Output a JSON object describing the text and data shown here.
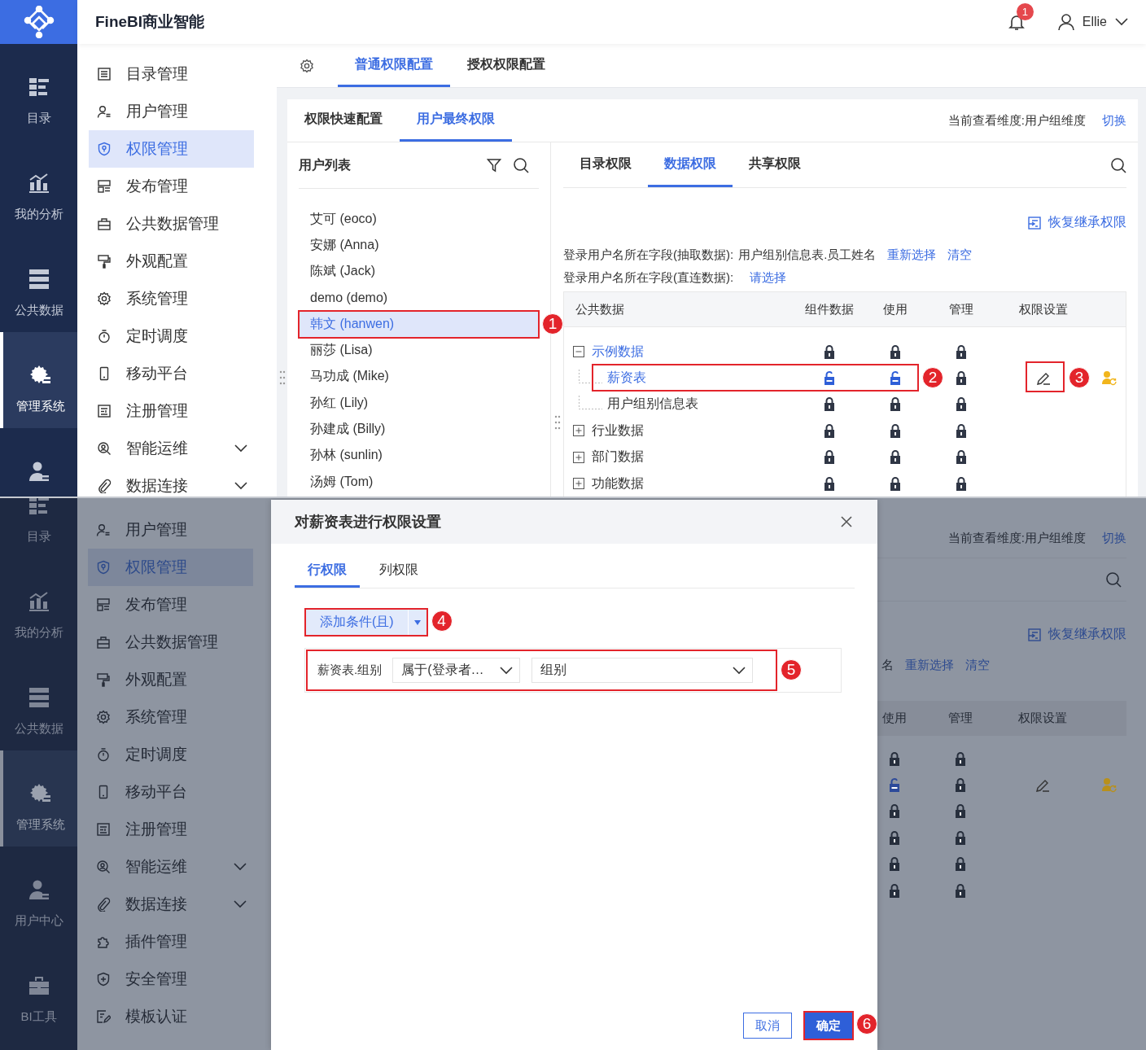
{
  "top_screen": {
    "app_title": "FineBI商业智能",
    "notification_count": "1",
    "user_name": "Ellie",
    "nav_rail": [
      {
        "label": "目录",
        "selected": false
      },
      {
        "label": "我的分析",
        "selected": false
      },
      {
        "label": "公共数据",
        "selected": false
      },
      {
        "label": "管理系统",
        "selected": true
      },
      {
        "selected": false
      }
    ],
    "menu": [
      {
        "label": "目录管理",
        "selected": false
      },
      {
        "label": "用户管理",
        "selected": false
      },
      {
        "label": "权限管理",
        "selected": true
      },
      {
        "label": "发布管理",
        "selected": false
      },
      {
        "label": "公共数据管理",
        "selected": false
      },
      {
        "label": "外观配置",
        "selected": false
      },
      {
        "label": "系统管理",
        "selected": false
      },
      {
        "label": "定时调度",
        "selected": false
      },
      {
        "label": "移动平台",
        "selected": false
      },
      {
        "label": "注册管理",
        "selected": false
      },
      {
        "label": "智能运维",
        "selected": false,
        "expanded": false
      },
      {
        "label": "数据连接",
        "selected": false,
        "expanded": false
      }
    ],
    "page_tabs": [
      {
        "label": "普通权限配置",
        "selected": true
      },
      {
        "label": "授权权限配置",
        "selected": false
      }
    ],
    "card_tabs": [
      {
        "label": "权限快速配置",
        "selected": false
      },
      {
        "label": "用户最终权限",
        "selected": true
      }
    ],
    "view_dimension": "当前查看维度:用户组维度",
    "switch_link": "切换",
    "user_list": {
      "title": "用户列表",
      "users": [
        {
          "name": "艾可 (eoco)",
          "selected": false
        },
        {
          "name": "安娜 (Anna)",
          "selected": false
        },
        {
          "name": "陈斌 (Jack)",
          "selected": false
        },
        {
          "name": "demo (demo)",
          "selected": false
        },
        {
          "name": "韩文 (hanwen)",
          "selected": true,
          "callout": "1"
        },
        {
          "name": "丽莎 (Lisa)",
          "selected": false
        },
        {
          "name": "马功成 (Mike)",
          "selected": false
        },
        {
          "name": "孙红 (Lily)",
          "selected": false
        },
        {
          "name": "孙建成 (Billy)",
          "selected": false
        },
        {
          "name": "孙林 (sunlin)",
          "selected": false
        },
        {
          "name": "汤姆 (Tom)",
          "selected": false
        }
      ]
    },
    "permission_tabs": [
      {
        "label": "目录权限",
        "selected": false
      },
      {
        "label": "数据权限",
        "selected": true
      },
      {
        "label": "共享权限",
        "selected": false
      }
    ],
    "restore_link": "恢复继承权限",
    "extract_field": {
      "label": "登录用户名所在字段(抽取数据):",
      "value": "用户组别信息表.员工姓名",
      "links": [
        "重新选择",
        "清空"
      ]
    },
    "direct_field": {
      "label": "登录用户名所在字段(直连数据):",
      "links": [
        "请选择"
      ]
    },
    "table": {
      "columns": [
        "公共数据",
        "组件数据",
        "使用",
        "管理",
        "权限设置"
      ],
      "rows": [
        {
          "name": "示例数据",
          "active": true,
          "expanded": true,
          "component_locked": true,
          "use_locked": true,
          "manage_locked": true,
          "has_settings": false,
          "children": [
            {
              "name": "薪资表",
              "active": true,
              "component_locked": false,
              "use_locked": false,
              "manage_locked": true,
              "has_settings": true,
              "callout": "2",
              "settings_callout": "3"
            },
            {
              "name": "用户组别信息表",
              "active": false,
              "component_locked": true,
              "use_locked": true,
              "manage_locked": true,
              "has_settings": false
            }
          ]
        },
        {
          "name": "行业数据",
          "active": false,
          "expanded": false,
          "component_locked": true,
          "use_locked": true,
          "manage_locked": true,
          "has_settings": false
        },
        {
          "name": "部门数据",
          "active": false,
          "expanded": false,
          "component_locked": true,
          "use_locked": true,
          "manage_locked": true,
          "has_settings": false
        },
        {
          "name": "功能数据",
          "active": false,
          "expanded": false,
          "component_locked": true,
          "use_locked": true,
          "manage_locked": true,
          "has_settings": false
        }
      ]
    }
  },
  "bottom_screen": {
    "nav_rail": [
      {
        "label": "目录",
        "selected": false
      },
      {
        "label": "我的分析",
        "selected": false
      },
      {
        "label": "公共数据",
        "selected": false
      },
      {
        "label": "管理系统",
        "selected": true
      },
      {
        "label": "用户中心",
        "selected": false
      },
      {
        "label": "BI工具",
        "selected": false
      }
    ],
    "menu": [
      {
        "label": "用户管理",
        "selected": false
      },
      {
        "label": "权限管理",
        "selected": true
      },
      {
        "label": "发布管理",
        "selected": false
      },
      {
        "label": "公共数据管理",
        "selected": false
      },
      {
        "label": "外观配置",
        "selected": false
      },
      {
        "label": "系统管理",
        "selected": false
      },
      {
        "label": "定时调度",
        "selected": false
      },
      {
        "label": "移动平台",
        "selected": false
      },
      {
        "label": "注册管理",
        "selected": false
      },
      {
        "label": "智能运维",
        "selected": false,
        "expanded": false
      },
      {
        "label": "数据连接",
        "selected": false,
        "expanded": false
      },
      {
        "label": "插件管理",
        "selected": false
      },
      {
        "label": "安全管理",
        "selected": false
      },
      {
        "label": "模板认证",
        "selected": false
      }
    ],
    "view_dimension": "当前查看维度:用户组维度",
    "switch_link": "切换",
    "restore_link": "恢复继承权限",
    "field_line": {
      "text": "名",
      "links": [
        "重新选择",
        "清空"
      ]
    },
    "table": {
      "columns": [
        "使用",
        "管理",
        "权限设置"
      ],
      "rows": [
        {
          "use_locked": true,
          "manage_locked": true,
          "has_settings": false
        },
        {
          "use_locked": false,
          "manage_locked": true,
          "has_settings": true
        },
        {
          "use_locked": true,
          "manage_locked": true,
          "has_settings": false
        },
        {
          "use_locked": true,
          "manage_locked": true,
          "has_settings": false
        },
        {
          "use_locked": true,
          "manage_locked": true,
          "has_settings": false
        },
        {
          "use_locked": true,
          "manage_locked": true,
          "has_settings": false
        }
      ]
    },
    "dialog": {
      "title": "对薪资表进行权限设置",
      "tabs": [
        {
          "label": "行权限",
          "selected": true
        },
        {
          "label": "列权限",
          "selected": false
        }
      ],
      "add_button": {
        "label": "添加条件(且)",
        "callout": "4"
      },
      "condition": {
        "field": "薪资表.组别",
        "operator": "属于(登录者…",
        "value": "组别",
        "callout": "5"
      },
      "buttons": [
        {
          "label": "取消",
          "kind": "secondary"
        },
        {
          "label": "确定",
          "kind": "primary",
          "callout": "6"
        }
      ]
    }
  }
}
